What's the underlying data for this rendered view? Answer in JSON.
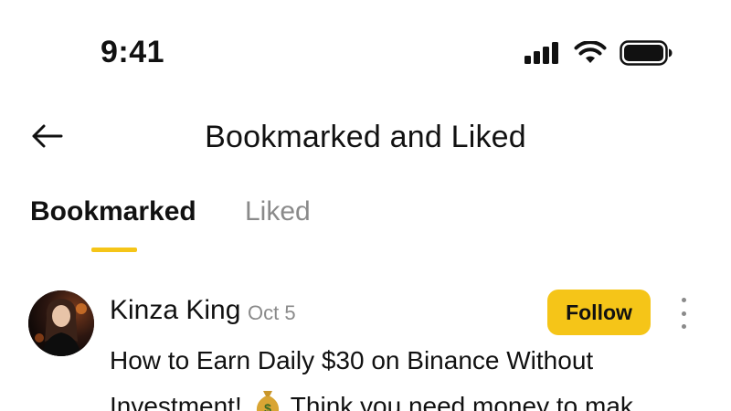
{
  "status_bar": {
    "time": "9:41",
    "icons": [
      "cellular-signal-icon",
      "wifi-icon",
      "battery-icon"
    ]
  },
  "header": {
    "back_icon": "arrow-left-icon",
    "title": "Bookmarked and Liked"
  },
  "tabs": [
    {
      "label": "Bookmarked",
      "active": true
    },
    {
      "label": "Liked",
      "active": false
    }
  ],
  "post": {
    "author": "Kinza King",
    "date": "Oct 5",
    "follow_label": "Follow",
    "more_icon": "more-vertical-icon",
    "text_line_1": "How to Earn Daily $30 on Binance Without",
    "text_line_2_start": "Investment!",
    "text_line_2_emoji": "money-bag-icon",
    "text_line_2_end": "Think you need money to mak"
  },
  "colors": {
    "accent": "#F5C518",
    "text_primary": "#111111",
    "text_secondary": "#8A8A8A",
    "background": "#FFFFFF"
  }
}
